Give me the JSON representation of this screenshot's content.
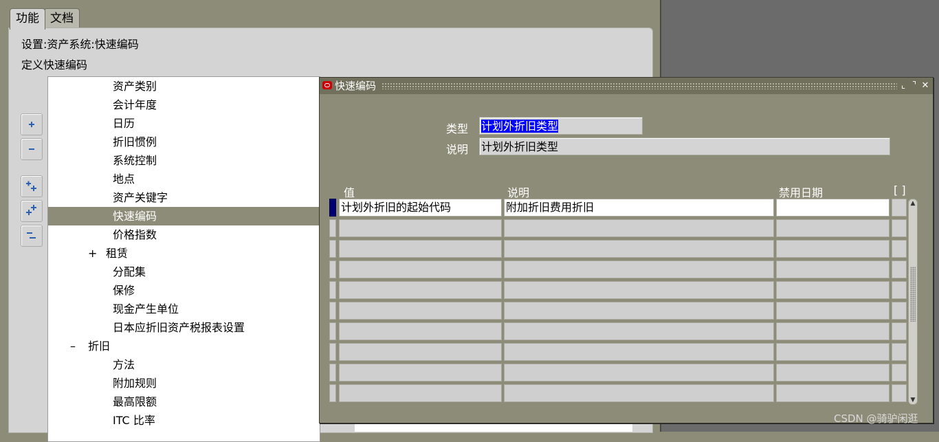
{
  "tabs": [
    {
      "label": "功能"
    },
    {
      "label": "文档"
    }
  ],
  "breadcrumb": "设置:资产系统:快速编码",
  "page_title": "定义快速编码",
  "tree": {
    "items": [
      {
        "label": "资产类别",
        "indent": 1,
        "toggle": "",
        "selected": false
      },
      {
        "label": "会计年度",
        "indent": 1,
        "toggle": "",
        "selected": false
      },
      {
        "label": "日历",
        "indent": 1,
        "toggle": "",
        "selected": false
      },
      {
        "label": "折旧惯例",
        "indent": 1,
        "toggle": "",
        "selected": false
      },
      {
        "label": "系统控制",
        "indent": 1,
        "toggle": "",
        "selected": false
      },
      {
        "label": "地点",
        "indent": 1,
        "toggle": "",
        "selected": false
      },
      {
        "label": "资产关键字",
        "indent": 1,
        "toggle": "",
        "selected": false
      },
      {
        "label": "快速编码",
        "indent": 1,
        "toggle": "",
        "selected": true
      },
      {
        "label": "价格指数",
        "indent": 1,
        "toggle": "",
        "selected": false
      },
      {
        "label": "租赁",
        "indent": 0.5,
        "toggle": "+",
        "selected": false
      },
      {
        "label": "分配集",
        "indent": 1,
        "toggle": "",
        "selected": false
      },
      {
        "label": "保修",
        "indent": 1,
        "toggle": "",
        "selected": false
      },
      {
        "label": "现金产生单位",
        "indent": 1,
        "toggle": "",
        "selected": false
      },
      {
        "label": "日本应折旧资产税报表设置",
        "indent": 1,
        "toggle": "",
        "selected": false
      },
      {
        "label": "折旧",
        "indent": 0,
        "toggle": "–",
        "selected": false
      },
      {
        "label": "方法",
        "indent": 1,
        "toggle": "",
        "selected": false
      },
      {
        "label": "附加规则",
        "indent": 1,
        "toggle": "",
        "selected": false
      },
      {
        "label": "最高限额",
        "indent": 1,
        "toggle": "",
        "selected": false
      },
      {
        "label": "ITC 比率",
        "indent": 1,
        "toggle": "",
        "selected": false
      }
    ]
  },
  "side_buttons": [
    {
      "name": "expand-icon"
    },
    {
      "name": "collapse-icon"
    },
    {
      "name": "expand-branch-icon"
    },
    {
      "name": "expand-all-icon"
    },
    {
      "name": "collapse-all-icon"
    }
  ],
  "dialog": {
    "title": "快速编码",
    "window_buttons": [
      "⌞",
      "⌝",
      "✕"
    ],
    "type_label": "类型",
    "type_value": "计划外折旧类型",
    "desc_label": "说明",
    "desc_value": "计划外折旧类型",
    "columns": {
      "value": "值",
      "description": "说明",
      "disabled_date": "禁用日期",
      "dff": "[ ]"
    },
    "rows": [
      {
        "value": "计划外折旧的起始代码",
        "description": "附加折旧费用折旧",
        "disabled_date": ""
      },
      {
        "value": "",
        "description": "",
        "disabled_date": ""
      },
      {
        "value": "",
        "description": "",
        "disabled_date": ""
      },
      {
        "value": "",
        "description": "",
        "disabled_date": ""
      },
      {
        "value": "",
        "description": "",
        "disabled_date": ""
      },
      {
        "value": "",
        "description": "",
        "disabled_date": ""
      },
      {
        "value": "",
        "description": "",
        "disabled_date": ""
      },
      {
        "value": "",
        "description": "",
        "disabled_date": ""
      },
      {
        "value": "",
        "description": "",
        "disabled_date": ""
      },
      {
        "value": "",
        "description": "",
        "disabled_date": ""
      }
    ]
  },
  "watermark": "CSDN @骑驴闲逛"
}
